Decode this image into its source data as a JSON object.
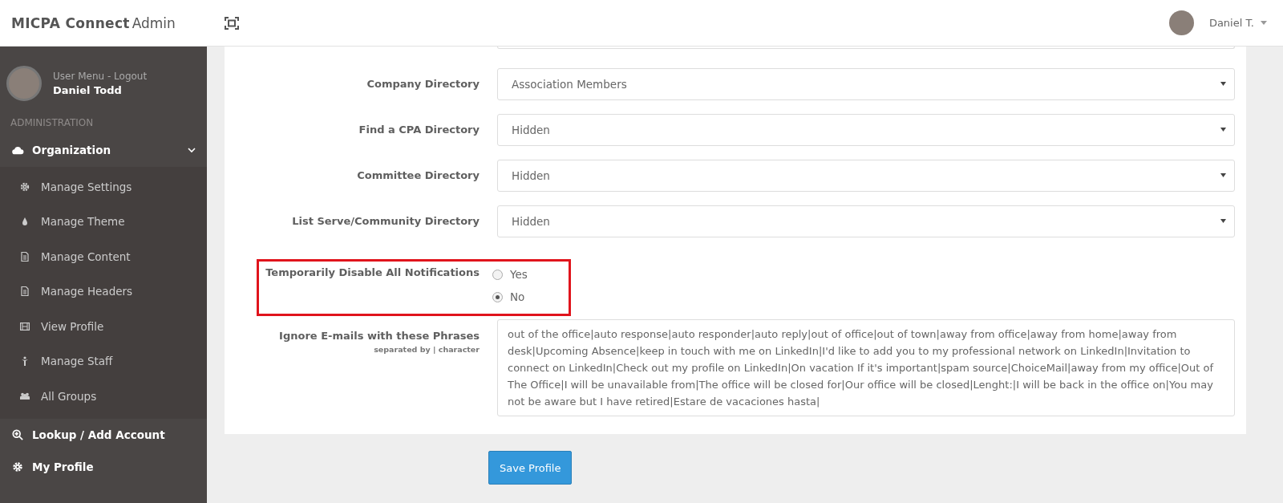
{
  "header": {
    "brand_bold": "MICPA Connect",
    "brand_light": "Admin",
    "user_name": "Daniel T."
  },
  "sidebar": {
    "user_menu": "User Menu - Logout",
    "user_name": "Daniel Todd",
    "section": "ADMINISTRATION",
    "items": [
      {
        "label": "Organization",
        "kind": "group",
        "expanded": true,
        "children": [
          {
            "label": "Manage Settings"
          },
          {
            "label": "Manage Theme"
          },
          {
            "label": "Manage Content"
          },
          {
            "label": "Manage Headers"
          },
          {
            "label": "View Profile"
          },
          {
            "label": "Manage Staff"
          },
          {
            "label": "All Groups"
          }
        ]
      },
      {
        "label": "Lookup / Add Account",
        "kind": "link"
      },
      {
        "label": "My Profile",
        "kind": "link"
      }
    ]
  },
  "form": {
    "rows": [
      {
        "kind": "select",
        "label": "Company Directory",
        "value": "Association Members"
      },
      {
        "kind": "select",
        "label": "Find a CPA Directory",
        "value": "Hidden"
      },
      {
        "kind": "select",
        "label": "Committee Directory",
        "value": "Hidden"
      },
      {
        "kind": "select",
        "label": "List Serve/Community Directory",
        "value": "Hidden"
      },
      {
        "kind": "radio",
        "label": "Temporarily Disable All Notifications",
        "highlighted": true,
        "options": [
          {
            "label": "Yes",
            "selected": false
          },
          {
            "label": "No",
            "selected": true
          }
        ]
      },
      {
        "kind": "textarea",
        "label": "Ignore E-mails with these Phrases",
        "hint": "separated by | character",
        "value": "out of the office|auto response|auto responder|auto reply|out of office|out of town|away from office|away from home|away from desk|Upcoming Absence|keep in touch with me on LinkedIn|I'd like to add you to my professional network on LinkedIn|Invitation to connect on LinkedIn|Check out my profile on LinkedIn|On vacation If it's important|spam source|ChoiceMail|away from my office|Out of The Office|I will be unavailable from|The office will be closed for|Our office will be closed|Lenght:|I will be back in the office on|You may not be aware but I have retired|Estare de vacaciones hasta|"
      }
    ],
    "save_button": "Save Profile"
  }
}
